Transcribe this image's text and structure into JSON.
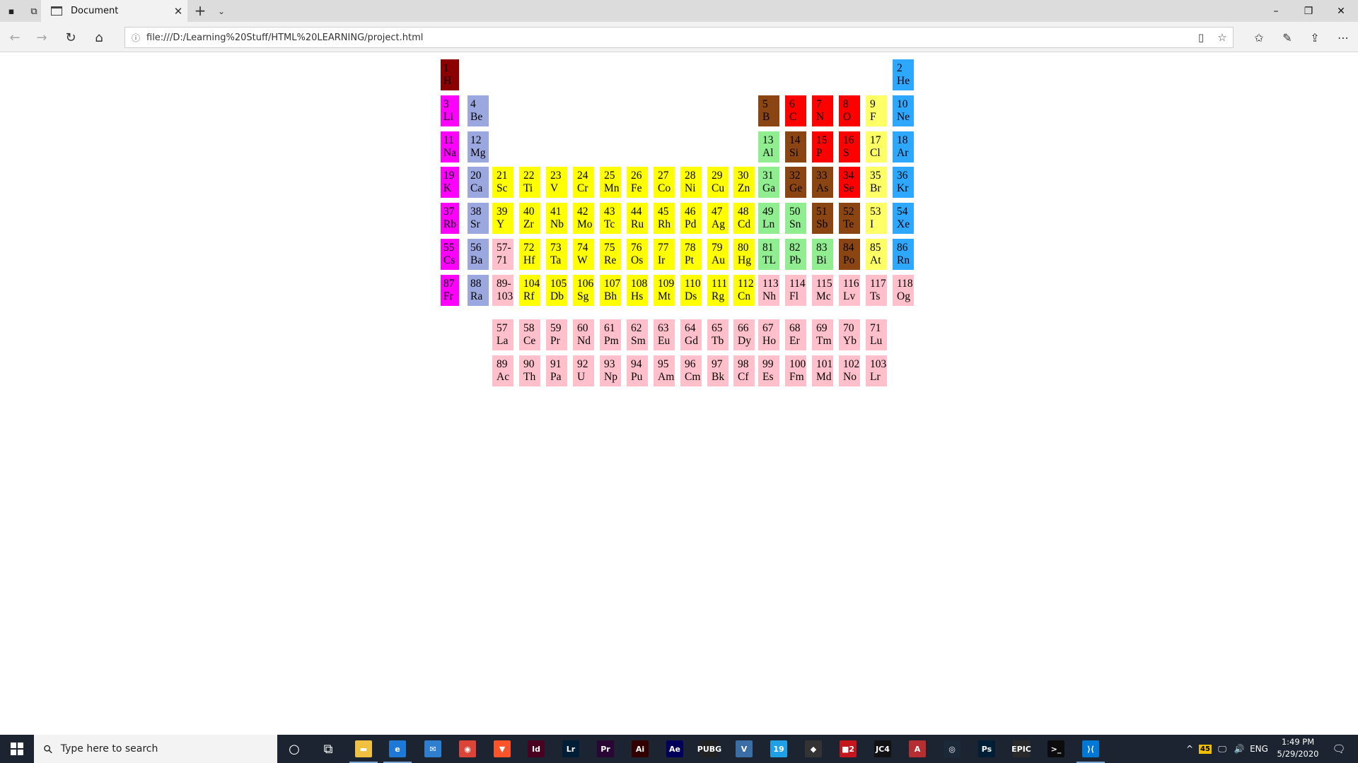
{
  "browser": {
    "tab_title": "Document",
    "tab_close": "✕",
    "new_tab": "+",
    "tab_list": "⌄",
    "url": "file:///D:/Learning%20Stuff/HTML%20LEARNING/project.html",
    "window_controls": {
      "minimize": "–",
      "restore": "❐",
      "close": "✕"
    }
  },
  "colors": {
    "alkali": "#ff00ff",
    "alkaline": "#9ba8e0",
    "transition": "#ffff00",
    "post_transition": "#90ee90",
    "metalloid": "#8b4513",
    "nonmetal": "#ff0000",
    "halogen": "#ffff66",
    "noble": "#2ea8ff",
    "lanthanide_actinide": "#ffc0cb",
    "hydrogen": "#8b0000"
  },
  "elements": [
    {
      "n": "1",
      "s": "H",
      "c": "hydrogen",
      "r": 0,
      "col": 0
    },
    {
      "n": "2",
      "s": "He",
      "c": "noble",
      "r": 0,
      "col": 17
    },
    {
      "n": "3",
      "s": "Li",
      "c": "alkali",
      "r": 1,
      "col": 0
    },
    {
      "n": "4",
      "s": "Be",
      "c": "alkaline",
      "r": 1,
      "col": 1
    },
    {
      "n": "5",
      "s": "B",
      "c": "metalloid",
      "r": 1,
      "col": 12
    },
    {
      "n": "6",
      "s": "C",
      "c": "nonmetal",
      "r": 1,
      "col": 13
    },
    {
      "n": "7",
      "s": "N",
      "c": "nonmetal",
      "r": 1,
      "col": 14
    },
    {
      "n": "8",
      "s": "O",
      "c": "nonmetal",
      "r": 1,
      "col": 15
    },
    {
      "n": "9",
      "s": "F",
      "c": "halogen",
      "r": 1,
      "col": 16
    },
    {
      "n": "10",
      "s": "Ne",
      "c": "noble",
      "r": 1,
      "col": 17
    },
    {
      "n": "11",
      "s": "Na",
      "c": "alkali",
      "r": 2,
      "col": 0
    },
    {
      "n": "12",
      "s": "Mg",
      "c": "alkaline",
      "r": 2,
      "col": 1
    },
    {
      "n": "13",
      "s": "Al",
      "c": "post_transition",
      "r": 2,
      "col": 12
    },
    {
      "n": "14",
      "s": "Si",
      "c": "metalloid",
      "r": 2,
      "col": 13
    },
    {
      "n": "15",
      "s": "P",
      "c": "nonmetal",
      "r": 2,
      "col": 14
    },
    {
      "n": "16",
      "s": "S",
      "c": "nonmetal",
      "r": 2,
      "col": 15
    },
    {
      "n": "17",
      "s": "Cl",
      "c": "halogen",
      "r": 2,
      "col": 16
    },
    {
      "n": "18",
      "s": "Ar",
      "c": "noble",
      "r": 2,
      "col": 17
    },
    {
      "n": "19",
      "s": "K",
      "c": "alkali",
      "r": 3,
      "col": 0
    },
    {
      "n": "20",
      "s": "Ca",
      "c": "alkaline",
      "r": 3,
      "col": 1
    },
    {
      "n": "21",
      "s": "Sc",
      "c": "transition",
      "r": 3,
      "col": 2
    },
    {
      "n": "22",
      "s": "Ti",
      "c": "transition",
      "r": 3,
      "col": 3
    },
    {
      "n": "23",
      "s": "V",
      "c": "transition",
      "r": 3,
      "col": 4
    },
    {
      "n": "24",
      "s": "Cr",
      "c": "transition",
      "r": 3,
      "col": 5
    },
    {
      "n": "25",
      "s": "Mn",
      "c": "transition",
      "r": 3,
      "col": 6
    },
    {
      "n": "26",
      "s": "Fe",
      "c": "transition",
      "r": 3,
      "col": 7
    },
    {
      "n": "27",
      "s": "Co",
      "c": "transition",
      "r": 3,
      "col": 8
    },
    {
      "n": "28",
      "s": "Ni",
      "c": "transition",
      "r": 3,
      "col": 9
    },
    {
      "n": "29",
      "s": "Cu",
      "c": "transition",
      "r": 3,
      "col": 10
    },
    {
      "n": "30",
      "s": "Zn",
      "c": "transition",
      "r": 3,
      "col": 11
    },
    {
      "n": "31",
      "s": "Ga",
      "c": "post_transition",
      "r": 3,
      "col": 12
    },
    {
      "n": "32",
      "s": "Ge",
      "c": "metalloid",
      "r": 3,
      "col": 13
    },
    {
      "n": "33",
      "s": "As",
      "c": "metalloid",
      "r": 3,
      "col": 14
    },
    {
      "n": "34",
      "s": "Se",
      "c": "nonmetal",
      "r": 3,
      "col": 15
    },
    {
      "n": "35",
      "s": "Br",
      "c": "halogen",
      "r": 3,
      "col": 16
    },
    {
      "n": "36",
      "s": "Kr",
      "c": "noble",
      "r": 3,
      "col": 17
    },
    {
      "n": "37",
      "s": "Rb",
      "c": "alkali",
      "r": 4,
      "col": 0
    },
    {
      "n": "38",
      "s": "Sr",
      "c": "alkaline",
      "r": 4,
      "col": 1
    },
    {
      "n": "39",
      "s": "Y",
      "c": "transition",
      "r": 4,
      "col": 2
    },
    {
      "n": "40",
      "s": "Zr",
      "c": "transition",
      "r": 4,
      "col": 3
    },
    {
      "n": "41",
      "s": "Nb",
      "c": "transition",
      "r": 4,
      "col": 4
    },
    {
      "n": "42",
      "s": "Mo",
      "c": "transition",
      "r": 4,
      "col": 5
    },
    {
      "n": "43",
      "s": "Tc",
      "c": "transition",
      "r": 4,
      "col": 6
    },
    {
      "n": "44",
      "s": "Ru",
      "c": "transition",
      "r": 4,
      "col": 7
    },
    {
      "n": "45",
      "s": "Rh",
      "c": "transition",
      "r": 4,
      "col": 8
    },
    {
      "n": "46",
      "s": "Pd",
      "c": "transition",
      "r": 4,
      "col": 9
    },
    {
      "n": "47",
      "s": "Ag",
      "c": "transition",
      "r": 4,
      "col": 10
    },
    {
      "n": "48",
      "s": "Cd",
      "c": "transition",
      "r": 4,
      "col": 11
    },
    {
      "n": "49",
      "s": "Ln",
      "c": "post_transition",
      "r": 4,
      "col": 12
    },
    {
      "n": "50",
      "s": "Sn",
      "c": "post_transition",
      "r": 4,
      "col": 13
    },
    {
      "n": "51",
      "s": "Sb",
      "c": "metalloid",
      "r": 4,
      "col": 14
    },
    {
      "n": "52",
      "s": "Te",
      "c": "metalloid",
      "r": 4,
      "col": 15
    },
    {
      "n": "53",
      "s": "I",
      "c": "halogen",
      "r": 4,
      "col": 16
    },
    {
      "n": "54",
      "s": "Xe",
      "c": "noble",
      "r": 4,
      "col": 17
    },
    {
      "n": "55",
      "s": "Cs",
      "c": "alkali",
      "r": 5,
      "col": 0
    },
    {
      "n": "56",
      "s": "Ba",
      "c": "alkaline",
      "r": 5,
      "col": 1
    },
    {
      "n": "57-",
      "s": "71",
      "c": "lanthanide_actinide",
      "r": 5,
      "col": 2
    },
    {
      "n": "72",
      "s": "Hf",
      "c": "transition",
      "r": 5,
      "col": 3
    },
    {
      "n": "73",
      "s": "Ta",
      "c": "transition",
      "r": 5,
      "col": 4
    },
    {
      "n": "74",
      "s": "W",
      "c": "transition",
      "r": 5,
      "col": 5
    },
    {
      "n": "75",
      "s": "Re",
      "c": "transition",
      "r": 5,
      "col": 6
    },
    {
      "n": "76",
      "s": "Os",
      "c": "transition",
      "r": 5,
      "col": 7
    },
    {
      "n": "77",
      "s": "Ir",
      "c": "transition",
      "r": 5,
      "col": 8
    },
    {
      "n": "78",
      "s": "Pt",
      "c": "transition",
      "r": 5,
      "col": 9
    },
    {
      "n": "79",
      "s": "Au",
      "c": "transition",
      "r": 5,
      "col": 10
    },
    {
      "n": "80",
      "s": "Hg",
      "c": "transition",
      "r": 5,
      "col": 11
    },
    {
      "n": "81",
      "s": "TL",
      "c": "post_transition",
      "r": 5,
      "col": 12
    },
    {
      "n": "82",
      "s": "Pb",
      "c": "post_transition",
      "r": 5,
      "col": 13
    },
    {
      "n": "83",
      "s": "Bi",
      "c": "post_transition",
      "r": 5,
      "col": 14
    },
    {
      "n": "84",
      "s": "Po",
      "c": "metalloid",
      "r": 5,
      "col": 15
    },
    {
      "n": "85",
      "s": "At",
      "c": "halogen",
      "r": 5,
      "col": 16
    },
    {
      "n": "86",
      "s": "Rn",
      "c": "noble",
      "r": 5,
      "col": 17
    },
    {
      "n": "87",
      "s": "Fr",
      "c": "alkali",
      "r": 6,
      "col": 0
    },
    {
      "n": "88",
      "s": "Ra",
      "c": "alkaline",
      "r": 6,
      "col": 1
    },
    {
      "n": "89-",
      "s": "103",
      "c": "lanthanide_actinide",
      "r": 6,
      "col": 2
    },
    {
      "n": "104",
      "s": "Rf",
      "c": "transition",
      "r": 6,
      "col": 3
    },
    {
      "n": "105",
      "s": "Db",
      "c": "transition",
      "r": 6,
      "col": 4
    },
    {
      "n": "106",
      "s": "Sg",
      "c": "transition",
      "r": 6,
      "col": 5
    },
    {
      "n": "107",
      "s": "Bh",
      "c": "transition",
      "r": 6,
      "col": 6
    },
    {
      "n": "108",
      "s": "Hs",
      "c": "transition",
      "r": 6,
      "col": 7
    },
    {
      "n": "109",
      "s": "Mt",
      "c": "transition",
      "r": 6,
      "col": 8
    },
    {
      "n": "110",
      "s": "Ds",
      "c": "transition",
      "r": 6,
      "col": 9
    },
    {
      "n": "111",
      "s": "Rg",
      "c": "transition",
      "r": 6,
      "col": 10
    },
    {
      "n": "112",
      "s": "Cn",
      "c": "transition",
      "r": 6,
      "col": 11
    },
    {
      "n": "113",
      "s": "Nh",
      "c": "lanthanide_actinide",
      "r": 6,
      "col": 12
    },
    {
      "n": "114",
      "s": "Fl",
      "c": "lanthanide_actinide",
      "r": 6,
      "col": 13
    },
    {
      "n": "115",
      "s": "Mc",
      "c": "lanthanide_actinide",
      "r": 6,
      "col": 14
    },
    {
      "n": "116",
      "s": "Lv",
      "c": "lanthanide_actinide",
      "r": 6,
      "col": 15
    },
    {
      "n": "117",
      "s": "Ts",
      "c": "lanthanide_actinide",
      "r": 6,
      "col": 16
    },
    {
      "n": "118",
      "s": "Og",
      "c": "lanthanide_actinide",
      "r": 6,
      "col": 17
    },
    {
      "n": "57",
      "s": "La",
      "c": "lanthanide_actinide",
      "r": 7,
      "col": 2
    },
    {
      "n": "58",
      "s": "Ce",
      "c": "lanthanide_actinide",
      "r": 7,
      "col": 3
    },
    {
      "n": "59",
      "s": "Pr",
      "c": "lanthanide_actinide",
      "r": 7,
      "col": 4
    },
    {
      "n": "60",
      "s": "Nd",
      "c": "lanthanide_actinide",
      "r": 7,
      "col": 5
    },
    {
      "n": "61",
      "s": "Pm",
      "c": "lanthanide_actinide",
      "r": 7,
      "col": 6
    },
    {
      "n": "62",
      "s": "Sm",
      "c": "lanthanide_actinide",
      "r": 7,
      "col": 7
    },
    {
      "n": "63",
      "s": "Eu",
      "c": "lanthanide_actinide",
      "r": 7,
      "col": 8
    },
    {
      "n": "64",
      "s": "Gd",
      "c": "lanthanide_actinide",
      "r": 7,
      "col": 9
    },
    {
      "n": "65",
      "s": "Tb",
      "c": "lanthanide_actinide",
      "r": 7,
      "col": 10
    },
    {
      "n": "66",
      "s": "Dy",
      "c": "lanthanide_actinide",
      "r": 7,
      "col": 11
    },
    {
      "n": "67",
      "s": "Ho",
      "c": "lanthanide_actinide",
      "r": 7,
      "col": 12
    },
    {
      "n": "68",
      "s": "Er",
      "c": "lanthanide_actinide",
      "r": 7,
      "col": 13
    },
    {
      "n": "69",
      "s": "Tm",
      "c": "lanthanide_actinide",
      "r": 7,
      "col": 14
    },
    {
      "n": "70",
      "s": "Yb",
      "c": "lanthanide_actinide",
      "r": 7,
      "col": 15
    },
    {
      "n": "71",
      "s": "Lu",
      "c": "lanthanide_actinide",
      "r": 7,
      "col": 16
    },
    {
      "n": "89",
      "s": "Ac",
      "c": "lanthanide_actinide",
      "r": 8,
      "col": 2
    },
    {
      "n": "90",
      "s": "Th",
      "c": "lanthanide_actinide",
      "r": 8,
      "col": 3
    },
    {
      "n": "91",
      "s": "Pa",
      "c": "lanthanide_actinide",
      "r": 8,
      "col": 4
    },
    {
      "n": "92",
      "s": "U",
      "c": "lanthanide_actinide",
      "r": 8,
      "col": 5
    },
    {
      "n": "93",
      "s": "Np",
      "c": "lanthanide_actinide",
      "r": 8,
      "col": 6
    },
    {
      "n": "94",
      "s": "Pu",
      "c": "lanthanide_actinide",
      "r": 8,
      "col": 7
    },
    {
      "n": "95",
      "s": "Am",
      "c": "lanthanide_actinide",
      "r": 8,
      "col": 8
    },
    {
      "n": "96",
      "s": "Cm",
      "c": "lanthanide_actinide",
      "r": 8,
      "col": 9
    },
    {
      "n": "97",
      "s": "Bk",
      "c": "lanthanide_actinide",
      "r": 8,
      "col": 10
    },
    {
      "n": "98",
      "s": "Cf",
      "c": "lanthanide_actinide",
      "r": 8,
      "col": 11
    },
    {
      "n": "99",
      "s": "Es",
      "c": "lanthanide_actinide",
      "r": 8,
      "col": 12
    },
    {
      "n": "100",
      "s": "Fm",
      "c": "lanthanide_actinide",
      "r": 8,
      "col": 13
    },
    {
      "n": "101",
      "s": "Md",
      "c": "lanthanide_actinide",
      "r": 8,
      "col": 14
    },
    {
      "n": "102",
      "s": "No",
      "c": "lanthanide_actinide",
      "r": 8,
      "col": 15
    },
    {
      "n": "103",
      "s": "Lr",
      "c": "lanthanide_actinide",
      "r": 8,
      "col": 16
    }
  ],
  "taskbar": {
    "search_placeholder": "Type here to search",
    "apps": [
      {
        "name": "cortana-icon",
        "label": "○",
        "color": "transparent"
      },
      {
        "name": "task-view-icon",
        "label": "⧉",
        "color": "transparent"
      },
      {
        "name": "file-explorer-icon",
        "label": "▬",
        "color": "#f0c040"
      },
      {
        "name": "edge-icon",
        "label": "e",
        "color": "#1e78d6"
      },
      {
        "name": "mail-icon",
        "label": "✉",
        "color": "#2f7fd1"
      },
      {
        "name": "chrome-icon",
        "label": "◉",
        "color": "#db4437"
      },
      {
        "name": "brave-icon",
        "label": "▼",
        "color": "#fb542b"
      },
      {
        "name": "indesign-icon",
        "label": "Id",
        "color": "#49021f"
      },
      {
        "name": "lightroom-icon",
        "label": "Lr",
        "color": "#001e36"
      },
      {
        "name": "premiere-icon",
        "label": "Pr",
        "color": "#2a0634"
      },
      {
        "name": "illustrator-icon",
        "label": "Ai",
        "color": "#330000"
      },
      {
        "name": "after-effects-icon",
        "label": "Ae",
        "color": "#00005b"
      },
      {
        "name": "pubg-icon",
        "label": "PUBG",
        "color": "#222222"
      },
      {
        "name": "vectorian-icon",
        "label": "V",
        "color": "#3a6ea5"
      },
      {
        "name": "app-19-icon",
        "label": "19",
        "color": "#1fa0e6"
      },
      {
        "name": "game-icon",
        "label": "◆",
        "color": "#333333"
      },
      {
        "name": "app-red-icon",
        "label": "■2",
        "color": "#c4161c"
      },
      {
        "name": "jc4-icon",
        "label": "JC4",
        "color": "#111111"
      },
      {
        "name": "angular-icon",
        "label": "A",
        "color": "#b52e31"
      },
      {
        "name": "steam-icon",
        "label": "◎",
        "color": "#1b2838"
      },
      {
        "name": "photoshop-icon",
        "label": "Ps",
        "color": "#001e36"
      },
      {
        "name": "epic-games-icon",
        "label": "EPIC",
        "color": "#2a2a2a"
      },
      {
        "name": "terminal-icon",
        "label": ">_",
        "color": "#0c0c0c"
      },
      {
        "name": "vscode-icon",
        "label": "⟩⟨",
        "color": "#0078d4"
      }
    ],
    "tray": {
      "chevron": "^",
      "badge": "45",
      "network": "🖵",
      "volume": "🔊",
      "lang": "ENG",
      "time": "1:49 PM",
      "date": "5/29/2020",
      "notifications": "🗨"
    }
  }
}
